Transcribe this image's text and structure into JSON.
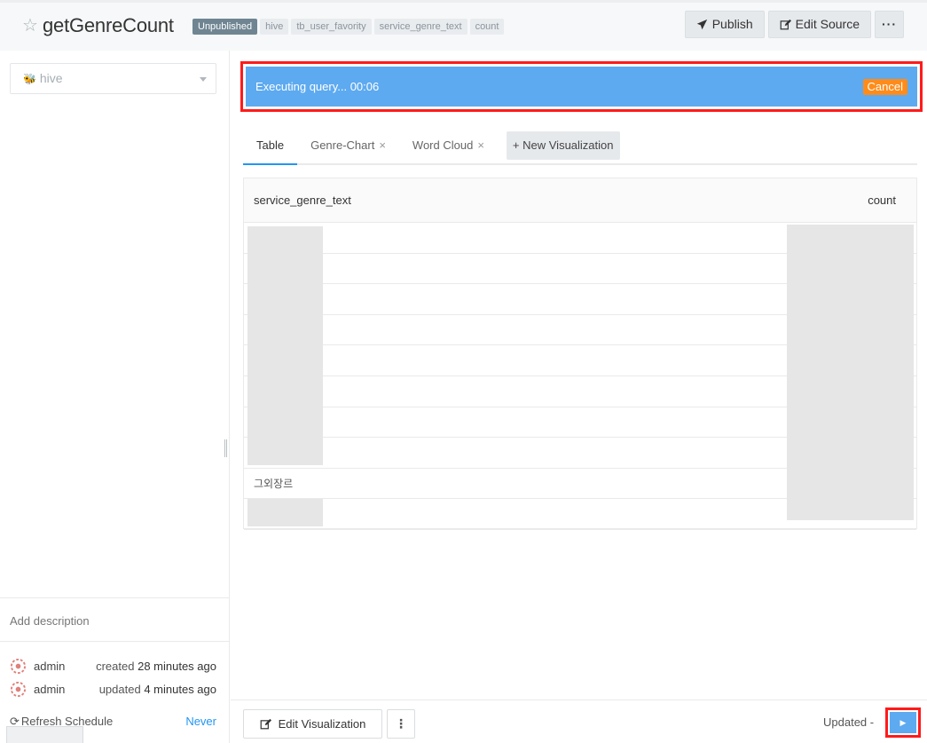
{
  "header": {
    "title": "getGenreCount",
    "status_tag": "Unpublished",
    "tags": [
      "hive",
      "tb_user_favority",
      "service_genre_text",
      "count"
    ],
    "publish_label": "Publish",
    "edit_source_label": "Edit Source",
    "more_label": "···"
  },
  "sidebar": {
    "datasource": "hive",
    "add_description": "Add description",
    "meta": [
      {
        "user": "admin",
        "action": "created",
        "time": "28 minutes ago"
      },
      {
        "user": "admin",
        "action": "updated",
        "time": "4 minutes ago"
      }
    ],
    "refresh_label": "Refresh Schedule",
    "refresh_value": "Never"
  },
  "execution": {
    "status_text": "Executing query... 00:06",
    "cancel_label": "Cancel"
  },
  "tabs": [
    {
      "label": "Table"
    },
    {
      "label": "Genre-Chart"
    },
    {
      "label": "Word Cloud"
    }
  ],
  "new_visualization_label": "+ New Visualization",
  "table": {
    "columns": [
      "service_genre_text",
      "count"
    ],
    "visible_cell": "그외장르"
  },
  "bottom": {
    "edit_visualization_label": "Edit Visualization",
    "updated_text": "Updated -"
  },
  "colors": {
    "accent": "#2196f3",
    "exec_bar": "#5daaf0",
    "cancel": "#ff8c1a",
    "highlight": "#ff1a1a"
  }
}
